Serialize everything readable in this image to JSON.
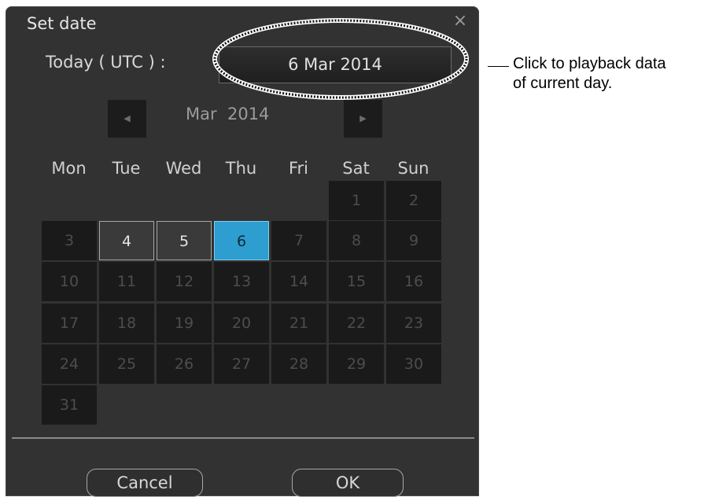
{
  "dialog": {
    "title": "Set date",
    "close_glyph": "×",
    "close_icon": "close-icon"
  },
  "today": {
    "label": "Today ( UTC ) :",
    "value": "6 Mar 2014"
  },
  "navigation": {
    "prev_icon": "triangle-left-icon",
    "prev_glyph": "◀",
    "next_icon": "triangle-right-icon",
    "next_glyph": "▶",
    "month_label": "Mar  2014"
  },
  "calendar": {
    "weekdays": [
      "Mon",
      "Tue",
      "Wed",
      "Thu",
      "Fri",
      "Sat",
      "Sun"
    ],
    "rows": [
      [
        null,
        null,
        null,
        null,
        null,
        "1",
        "2"
      ],
      [
        "3",
        "4",
        "5",
        "6",
        "7",
        "8",
        "9"
      ],
      [
        "10",
        "11",
        "12",
        "13",
        "14",
        "15",
        "16"
      ],
      [
        "17",
        "18",
        "19",
        "20",
        "21",
        "22",
        "23"
      ],
      [
        "24",
        "25",
        "26",
        "27",
        "28",
        "29",
        "30"
      ],
      [
        "31",
        null,
        null,
        null,
        null,
        null,
        null
      ]
    ],
    "enabled_days": [
      "4",
      "5"
    ],
    "selected_day": "6"
  },
  "buttons": {
    "cancel": "Cancel",
    "ok": "OK"
  },
  "annotation": {
    "line1": "Click to playback data",
    "line2": "of current day."
  },
  "colors": {
    "dialog_bg": "#323232",
    "selected_day": "#2e9dcf",
    "disabled_day_bg": "#1a1a1a"
  }
}
